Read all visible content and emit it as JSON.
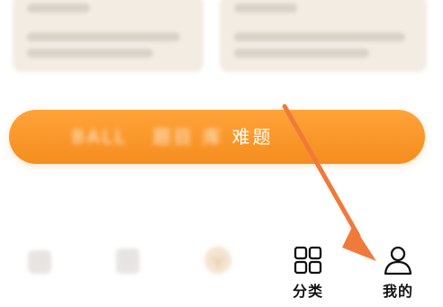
{
  "cta": {
    "text_clear": "难题",
    "text_blurred_parts": [
      "BALL",
      "题目",
      "库"
    ]
  },
  "tabbar": {
    "tabs": [
      {
        "icon": "home-icon",
        "label": ""
      },
      {
        "icon": "book-icon",
        "label": ""
      },
      {
        "icon": "vip-gem-icon",
        "label": ""
      },
      {
        "icon": "grid-four-squares-icon",
        "label": "分类"
      },
      {
        "icon": "person-icon",
        "label": "我的"
      }
    ]
  },
  "colors": {
    "accent_orange": "#f58d1f",
    "arrow": "#f07a3a",
    "gold": "#d5a56a"
  }
}
